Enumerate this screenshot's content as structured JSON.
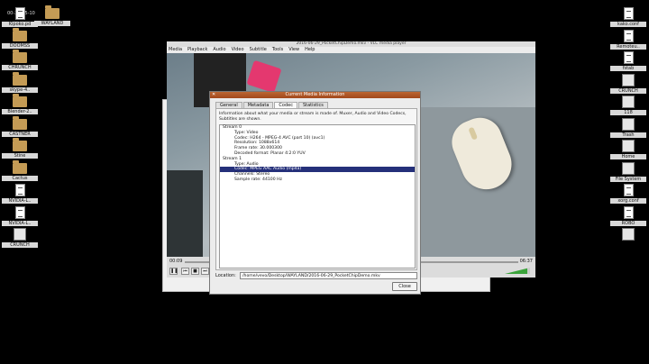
{
  "desktop": {
    "clock": "00-28-15-10",
    "left_icons": [
      {
        "label": "Kipoko.pd",
        "icon": "document-icon",
        "kind": "doc"
      },
      {
        "label": "WAYLAND",
        "icon": "folder-icon",
        "kind": "folder"
      },
      {
        "label": "DOOMSS",
        "icon": "folder-icon",
        "kind": "folder"
      },
      {
        "label": "CHRUNCH",
        "icon": "folder-icon",
        "kind": "folder"
      },
      {
        "label": "skype-4..",
        "icon": "folder-icon",
        "kind": "folder"
      },
      {
        "label": "Blender-2..",
        "icon": "folder-icon",
        "kind": "folder"
      },
      {
        "label": "CASTNER",
        "icon": "folder-icon",
        "kind": "folder"
      },
      {
        "label": "Stine",
        "icon": "folder-icon",
        "kind": "folder"
      },
      {
        "label": "Cactus",
        "icon": "folder-icon",
        "kind": "folder"
      },
      {
        "label": "NVIDIA-L..",
        "icon": "document-icon",
        "kind": "doc"
      },
      {
        "label": "NVIDIA-L..",
        "icon": "document-icon",
        "kind": "doc"
      },
      {
        "label": "CRUNCH",
        "icon": "drive-icon",
        "kind": "box"
      }
    ],
    "right_icons": [
      {
        "label": "kako.conf",
        "icon": "document-icon",
        "kind": "doc"
      },
      {
        "label": "Remoteu..",
        "icon": "document-icon",
        "kind": "doc"
      },
      {
        "label": "fstab",
        "icon": "document-icon",
        "kind": "doc"
      },
      {
        "label": "CRUNCH",
        "icon": "drive-icon",
        "kind": "box"
      },
      {
        "label": "118",
        "icon": "drive-icon",
        "kind": "box"
      },
      {
        "label": "Trash",
        "icon": "trash-icon",
        "kind": "box"
      },
      {
        "label": "Home",
        "icon": "home-icon",
        "kind": "box"
      },
      {
        "label": "File System",
        "icon": "drive-icon",
        "kind": "box"
      },
      {
        "label": "xorg.conf",
        "icon": "document-icon",
        "kind": "doc"
      },
      {
        "label": "ROBO",
        "icon": "document-icon",
        "kind": "doc"
      },
      {
        "label": "",
        "icon": "speaker-icon",
        "kind": "box"
      }
    ]
  },
  "vlc": {
    "title": "2016-06-29_PocketChipDemo.mkv - VLC media player",
    "menu": [
      "Media",
      "Playback",
      "Audio",
      "Video",
      "Subtitle",
      "Tools",
      "View",
      "Help"
    ],
    "time_elapsed": "00:09",
    "time_total": "06:37",
    "volume_percent": 90
  },
  "dialog": {
    "title": "Current Media Information",
    "tabs": [
      "General",
      "Metadata",
      "Codec",
      "Statistics"
    ],
    "active_tab": "Codec",
    "description": "Information about what your media or stream is made of. Muxer, Audio and Video Codecs, Subtitles are shown.",
    "tree": [
      {
        "text": "Stream 0",
        "level": 0
      },
      {
        "text": "Type: Video",
        "level": 1
      },
      {
        "text": "Codec: H264 - MPEG-4 AVC (part 10) (avc1)",
        "level": 1
      },
      {
        "text": "Resolution: 1088x614",
        "level": 1
      },
      {
        "text": "Frame rate: 30.000300",
        "level": 1
      },
      {
        "text": "Decoded format: Planar 4:2:0 YUV",
        "level": 1
      },
      {
        "text": "Stream 1",
        "level": 0
      },
      {
        "text": "Type: Audio",
        "level": 1
      },
      {
        "text": "Codec: MPEG AAC Audio (mp4a)",
        "level": 1,
        "selected": true
      },
      {
        "text": "Channels: Stereo",
        "level": 1
      },
      {
        "text": "Sample rate: 44100 Hz",
        "level": 1
      }
    ],
    "location_label": "Location:",
    "location_value": "/home/vevo/Desktop/WAYLAND/2016-06-29_PocketChipDemo.mkv",
    "close_label": "Close"
  }
}
